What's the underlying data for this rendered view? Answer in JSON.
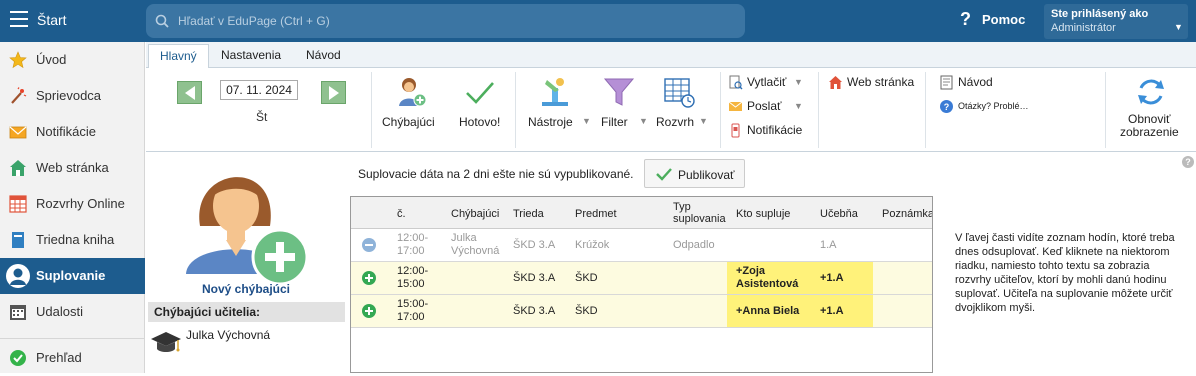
{
  "topbar": {
    "app_title": "Štart",
    "search_placeholder": "Hľadať v EduPage (Ctrl + G)",
    "help_label": "Pomoc",
    "user_line1": "Ste prihlásený ako",
    "user_line2": "Administrátor",
    "bg_color": "#1d5c8e"
  },
  "sidebar": {
    "items": [
      {
        "label": "Úvod",
        "icon": "star-icon"
      },
      {
        "label": "Sprievodca",
        "icon": "magic-wand-icon"
      },
      {
        "label": "Notifikácie",
        "icon": "envelope-icon"
      },
      {
        "label": "Web stránka",
        "icon": "house-icon"
      },
      {
        "label": "Rozvrhy Online",
        "icon": "timetable-grid-icon"
      },
      {
        "label": "Triedna kniha",
        "icon": "book-icon"
      },
      {
        "label": "Suplovanie",
        "icon": "person-icon",
        "active": true
      },
      {
        "label": "Udalosti",
        "icon": "calendar-icon"
      },
      {
        "label": "Prehľad",
        "icon": "check-circle-icon"
      }
    ]
  },
  "tabs": [
    {
      "label": "Hlavný",
      "active": true
    },
    {
      "label": "Nastavenia"
    },
    {
      "label": "Návod"
    }
  ],
  "ribbon": {
    "date": "07. 11. 2024",
    "day": "Št",
    "absent_label": "Chýbajúci",
    "done_label": "Hotovo!",
    "tools_label": "Nástroje",
    "filter_label": "Filter",
    "timetable_label": "Rozvrh",
    "print_label": "Vytlačiť",
    "send_label": "Poslať",
    "notifications_label": "Notifikácie",
    "web_label": "Web stránka",
    "guide_label": "Návod",
    "questions_label": "Otázky? Problé…",
    "refresh_label_1": "Obnoviť",
    "refresh_label_2": "zobrazenie"
  },
  "left_panel": {
    "new_absent": "Nový chýbajúci",
    "absent_header": "Chýbajúci učitelia:",
    "absent_teachers": [
      "Julka Výchovná"
    ]
  },
  "notice": {
    "text": "Suplovacie dáta na 2 dni ešte nie sú vypublikované.",
    "publish_button": "Publikovať"
  },
  "table": {
    "columns": [
      "č.",
      "Chýbajúci",
      "Trieda",
      "Predmet",
      "Typ suplovania",
      "Kto supluje",
      "Učebňa",
      "Poznámka"
    ],
    "column_typ_1": "Typ",
    "column_typ_2": "suplovania",
    "rows": [
      {
        "time1": "12:00-",
        "time2": "17:00",
        "absent1": "Julka",
        "absent2": "Výchovná",
        "class": "ŠKD 3.A",
        "subject": "Krúžok",
        "type": "Odpadlo",
        "who1": "",
        "who2": "",
        "room": "1.A",
        "status": "removed"
      },
      {
        "time1": "12:00-",
        "time2": "15:00",
        "absent1": "",
        "absent2": "",
        "class": "ŠKD 3.A",
        "subject": "ŠKD",
        "type": "",
        "who1": "+Zoja",
        "who2": "Asistentová",
        "room": "+1.A",
        "status": "added"
      },
      {
        "time1": "15:00-",
        "time2": "17:00",
        "absent1": "",
        "absent2": "",
        "class": "ŠKD 3.A",
        "subject": "ŠKD",
        "type": "",
        "who1": "+Anna Biela",
        "who2": "",
        "room": "+1.A",
        "status": "added"
      }
    ]
  },
  "help_text": "V ľavej časti vidíte zoznam hodín, ktoré treba dnes odsuplovať. Keď kliknete na niektorom riadku, namiesto tohto textu sa zobrazia rozvrhy učiteľov, ktorí by mohli danú hodinu suplovať. Učiteľa na suplovanie môžete určiť dvojklikom myši.",
  "help_mark": "?"
}
